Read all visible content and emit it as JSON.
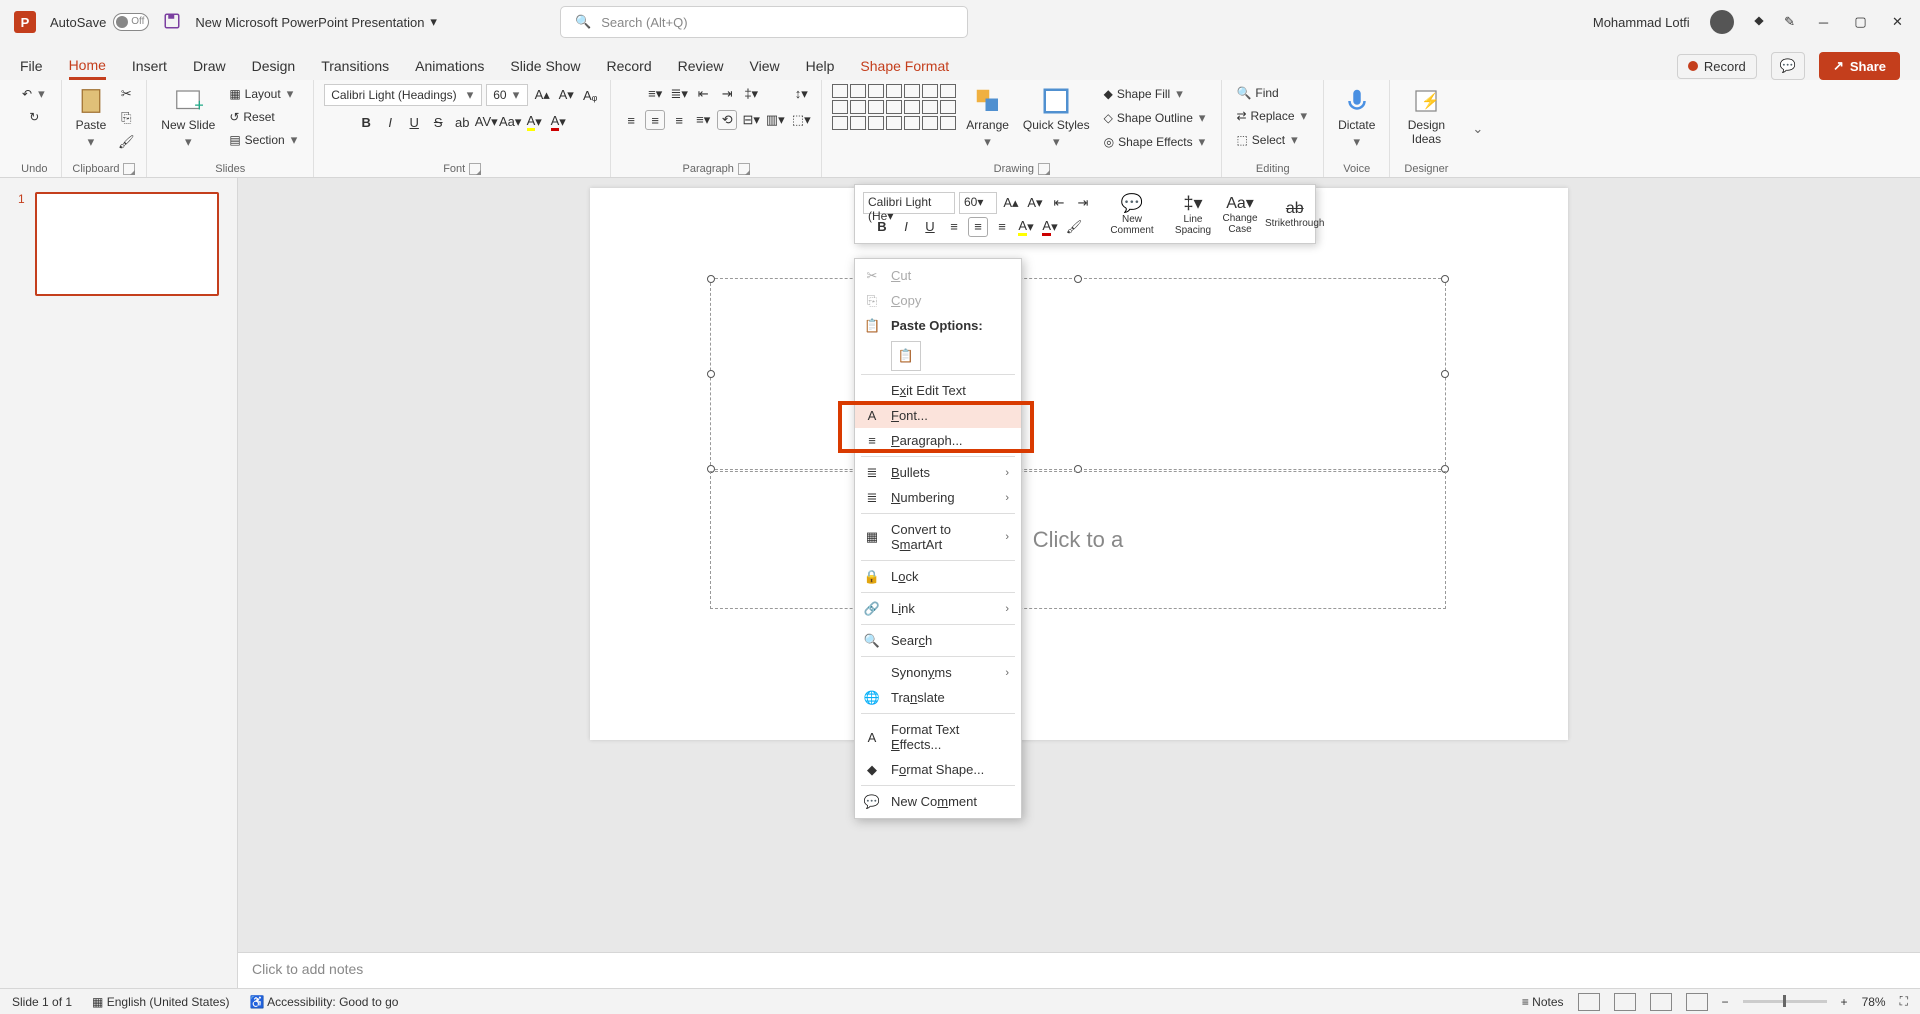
{
  "title_bar": {
    "app_letter": "P",
    "autosave_label": "AutoSave",
    "autosave_state": "Off",
    "doc_name": "New Microsoft PowerPoint Presentation",
    "search_placeholder": "Search (Alt+Q)",
    "user_name": "Mohammad Lotfi"
  },
  "tabs": {
    "file": "File",
    "home": "Home",
    "insert": "Insert",
    "draw": "Draw",
    "design": "Design",
    "transitions": "Transitions",
    "animations": "Animations",
    "slideshow": "Slide Show",
    "record": "Record",
    "review": "Review",
    "view": "View",
    "help": "Help",
    "shape_format": "Shape Format",
    "record_btn": "Record",
    "share": "Share"
  },
  "ribbon": {
    "undo": "Undo",
    "paste": "Paste",
    "clipboard": "Clipboard",
    "new_slide": "New Slide",
    "layout": "Layout",
    "reset": "Reset",
    "section": "Section",
    "slides": "Slides",
    "font_name": "Calibri Light (Headings)",
    "font_size": "60",
    "font": "Font",
    "paragraph": "Paragraph",
    "arrange": "Arrange",
    "quick_styles": "Quick Styles",
    "shape_fill": "Shape Fill",
    "shape_outline": "Shape Outline",
    "shape_effects": "Shape Effects",
    "drawing": "Drawing",
    "find": "Find",
    "replace": "Replace",
    "select": "Select",
    "editing": "Editing",
    "dictate": "Dictate",
    "voice": "Voice",
    "design_ideas": "Design Ideas",
    "designer": "Designer"
  },
  "mini": {
    "font_name": "Calibri Light (He",
    "font_size": "60",
    "new_comment": "New Comment",
    "line_spacing": "Line Spacing",
    "change_case": "Change Case",
    "strike": "Strikethrough"
  },
  "context": {
    "cut": "Cut",
    "copy": "Copy",
    "paste_options": "Paste Options:",
    "exit_edit": "Exit Edit Text",
    "font": "Font...",
    "paragraph": "Paragraph...",
    "bullets": "Bullets",
    "numbering": "Numbering",
    "smartart": "Convert to SmartArt",
    "lock": "Lock",
    "link": "Link",
    "search": "Search",
    "synonyms": "Synonyms",
    "translate": "Translate",
    "text_effects": "Format Text Effects...",
    "format_shape": "Format Shape...",
    "new_comment": "New Comment"
  },
  "slide": {
    "subtitle_placeholder": "Click to a",
    "number": "1"
  },
  "notes": {
    "placeholder": "Click to add notes"
  },
  "status": {
    "slide_info": "Slide 1 of 1",
    "language": "English (United States)",
    "accessibility": "Accessibility: Good to go",
    "notes_btn": "Notes",
    "zoom": "78%"
  }
}
